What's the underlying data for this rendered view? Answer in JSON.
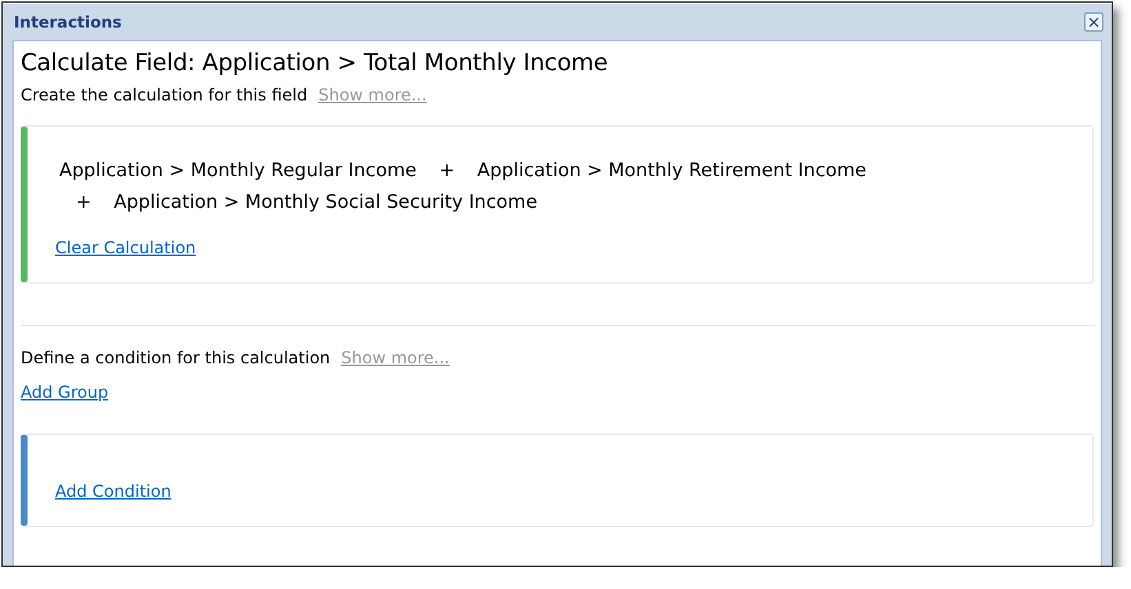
{
  "window": {
    "title": "Interactions",
    "close": "×"
  },
  "heading": "Calculate Field: Application > Total Monthly Income",
  "calculation": {
    "prompt": "Create the calculation for this field",
    "show_more": "Show more...",
    "formula": [
      {
        "kind": "field",
        "text": "Application > Monthly Regular Income"
      },
      {
        "kind": "operator",
        "text": "+"
      },
      {
        "kind": "field",
        "text": "Application > Monthly Retirement Income"
      },
      {
        "kind": "operator",
        "text": "+"
      },
      {
        "kind": "field",
        "text": "Application > Monthly Social Security Income"
      }
    ],
    "clear_link": "Clear Calculation"
  },
  "condition": {
    "prompt": "Define a condition for this calculation",
    "show_more": "Show more...",
    "add_group": "Add Group",
    "add_condition": "Add Condition"
  }
}
